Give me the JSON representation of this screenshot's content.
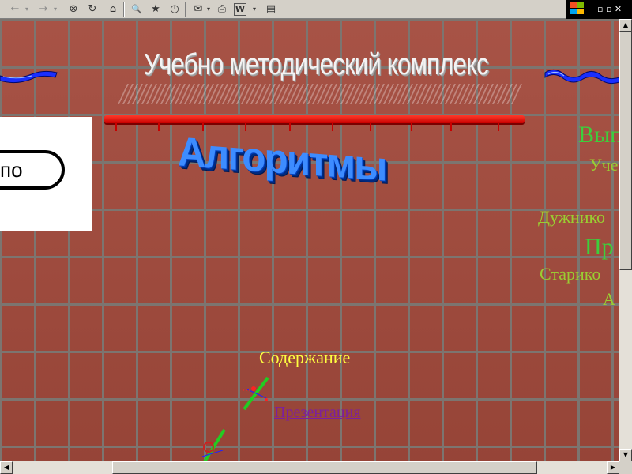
{
  "toolbar": {
    "back_icon": "←",
    "forward_icon": "→",
    "stop_icon": "⊗",
    "refresh_icon": "↻",
    "home_icon": "⌂",
    "search_icon": "🔍",
    "favorites_icon": "★",
    "history_icon": "◷",
    "mail_icon": "✉",
    "print_icon": "⎙",
    "edit_icon": "W",
    "discuss_icon": "▤"
  },
  "page": {
    "title": "Учебно методический комплекс",
    "panel_text": "по",
    "heading": "Алгоритмы",
    "right_column": [
      {
        "text": "Вып",
        "color": "#3ccf3c",
        "size": 30
      },
      {
        "text": "Уче",
        "color": "#9acd32",
        "size": 22
      },
      {
        "text": "Дужнико",
        "color": "#9acd32",
        "size": 22
      },
      {
        "text": "Пр",
        "color": "#3ccf3c",
        "size": 30
      },
      {
        "text": "Старико",
        "color": "#9acd32",
        "size": 22
      },
      {
        "text": "А",
        "color": "#9acd32",
        "size": 22
      }
    ],
    "contents_label": "Содержание",
    "presentation_link": "Презентация"
  },
  "colors": {
    "brick": "#a34a3c",
    "mortar": "#7c7570",
    "heading_blue": "#3d8cff",
    "contents_yellow": "#ffff40",
    "link_purple": "#7b1fa0",
    "red_bar": "#e01010"
  }
}
